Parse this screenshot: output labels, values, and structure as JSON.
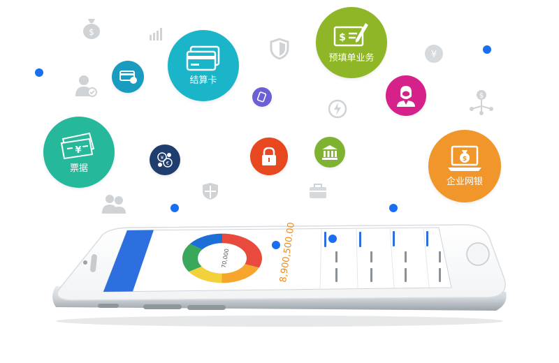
{
  "features": {
    "settlement_card": {
      "label": "结算卡",
      "icon": "card-icon",
      "color": "#1ab5c8"
    },
    "prefill_service": {
      "label": "预填单业务",
      "icon": "cheque-pen-icon",
      "color": "#8eb627"
    },
    "bills": {
      "label": "票据",
      "icon": "banknotes-icon",
      "color": "#26b89a"
    },
    "enterprise_banking": {
      "label": "企业网银",
      "icon": "laptop-money-icon",
      "color": "#f0962a"
    },
    "small_icons": [
      {
        "icon": "card-coin-icon",
        "color": "#1a9cc0"
      },
      {
        "icon": "phone-card-icon",
        "color": "#6c5fd6"
      },
      {
        "icon": "customer-service-icon",
        "color": "#d6208a"
      },
      {
        "icon": "currency-exchange-icon",
        "color": "#1f3d6e"
      },
      {
        "icon": "padlock-icon",
        "color": "#e8481f"
      },
      {
        "icon": "bank-building-icon",
        "color": "#7fb230"
      }
    ]
  },
  "phone": {
    "balance": "8,900,500.00",
    "donut_center": "70,000",
    "donut_colors": [
      "#e84a3d",
      "#f8a52e",
      "#f3d13b",
      "#3aa85a",
      "#1d6fd8"
    ],
    "header_color": "#2e6fe0"
  }
}
